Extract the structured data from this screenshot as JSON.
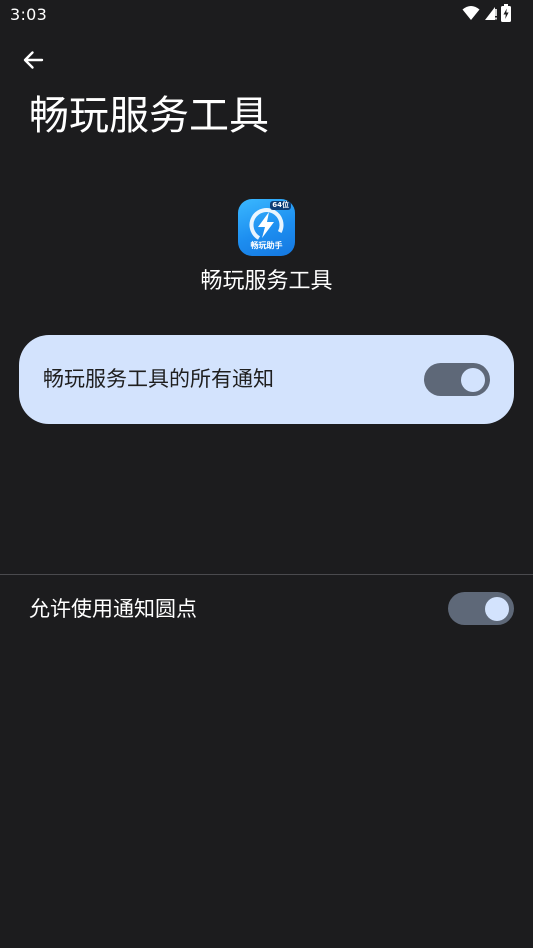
{
  "status_bar": {
    "time": "3:03",
    "icons": [
      "wifi-icon",
      "cell-signal-icon",
      "battery-charging-icon"
    ]
  },
  "header": {
    "back_icon": "arrow-back-icon",
    "title": "畅玩服务工具"
  },
  "app": {
    "name": "畅玩服务工具",
    "icon_badge": "64位",
    "icon_label": "畅玩助手",
    "icon_color": "#1d8ef0"
  },
  "settings": {
    "all_notifications": {
      "label": "畅玩服务工具的所有通知",
      "enabled": true
    },
    "notification_dot": {
      "label": "允许使用通知圆点",
      "enabled": true
    }
  },
  "colors": {
    "background": "#1c1c1e",
    "card": "#d3e3fd",
    "switch_track": "#5e6878",
    "switch_thumb": "#d3e3fd"
  }
}
